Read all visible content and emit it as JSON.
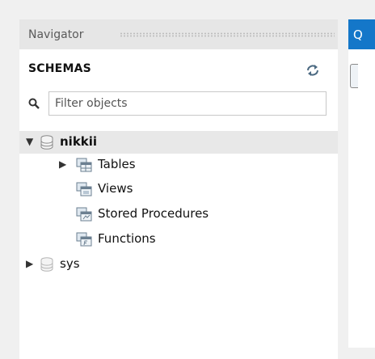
{
  "navigator": {
    "title": "Navigator",
    "schemas_label": "SCHEMAS",
    "refresh_icon": "refresh-icon",
    "search_icon": "magnifier-icon",
    "filter": {
      "placeholder": "Filter objects",
      "value": ""
    },
    "tree": [
      {
        "label": "nikkii",
        "level": 0,
        "expanded": true,
        "selected": true,
        "icon": "database-icon"
      },
      {
        "label": "Tables",
        "level": 1,
        "expanded": false,
        "icon": "table-folder-icon"
      },
      {
        "label": "Views",
        "level": 1,
        "icon": "view-folder-icon"
      },
      {
        "label": "Stored Procedures",
        "level": 1,
        "icon": "procedure-folder-icon"
      },
      {
        "label": "Functions",
        "level": 1,
        "icon": "function-folder-icon"
      },
      {
        "label": "sys",
        "level": 0,
        "expanded": false,
        "icon": "database-icon"
      }
    ]
  },
  "query_tab": {
    "label": "Q"
  },
  "colors": {
    "accent": "#1477c9",
    "panel_header": "#e6e6e6",
    "selected_row": "#e8e8e8"
  }
}
